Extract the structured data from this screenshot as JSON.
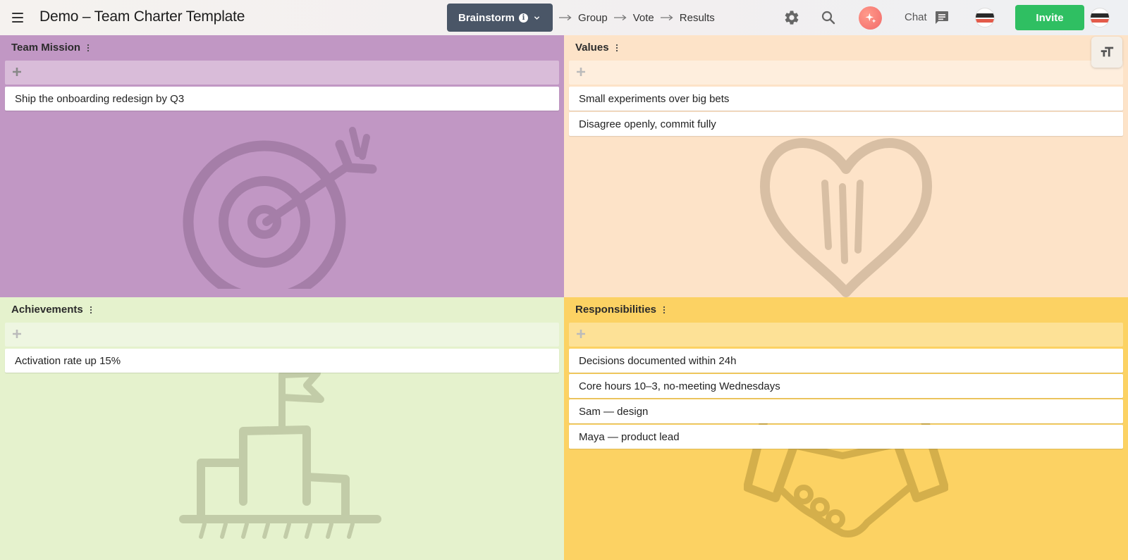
{
  "header": {
    "title": "Demo – Team Charter Template",
    "stages": {
      "active": "Brainstorm",
      "next": [
        "Group",
        "Vote",
        "Results"
      ]
    },
    "chat_label": "Chat",
    "invite_label": "Invite"
  },
  "icons": {
    "menu": "menu-icon",
    "settings": "gear-icon",
    "search": "search-icon",
    "ai": "sparkle-icon",
    "chat": "chat-bubble-icon",
    "text_size": "text-size-icon"
  },
  "colors": {
    "mission": "#c197c4",
    "values": "#fde3c8",
    "achievements": "#e5f2cd",
    "responsibilities": "#fcd263",
    "invite": "#2fbf62",
    "stage_active": "#4a5667"
  },
  "board": {
    "mission": {
      "title": "Team Mission",
      "cards": [
        "Ship the onboarding redesign by Q3"
      ]
    },
    "values": {
      "title": "Values",
      "cards": [
        "Small experiments over big bets",
        "Disagree openly, commit fully"
      ]
    },
    "achievements": {
      "title": "Achievements",
      "cards": [
        "Activation rate up 15%"
      ]
    },
    "responsibilities": {
      "title": "Responsibilities",
      "cards": [
        "Decisions documented within 24h",
        "Core hours 10–3, no-meeting Wednesdays",
        "Sam — design",
        "Maya — product lead"
      ]
    }
  }
}
